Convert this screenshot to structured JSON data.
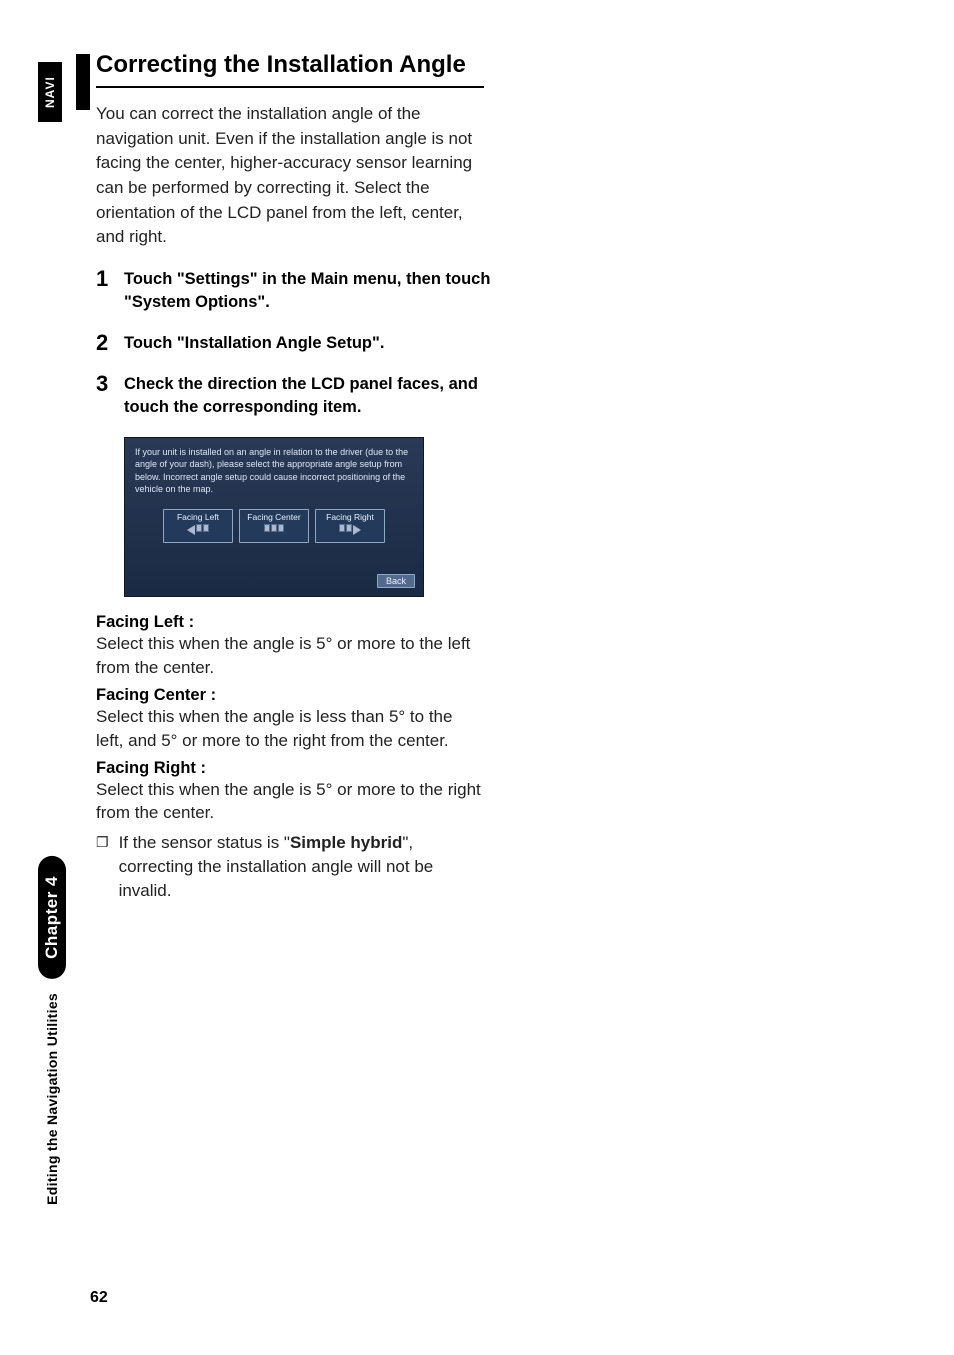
{
  "side": {
    "navi": "NAVI",
    "chapter": "Chapter 4",
    "section": "Editing the Navigation Utilities"
  },
  "page_number": "62",
  "title": "Correcting the Installation Angle",
  "intro": "You can correct the installation angle of the navigation unit. Even if the installation angle is not facing the center, higher-accuracy sensor learning can be performed by correcting it. Select the orientation of the LCD panel from the left, center, and right.",
  "steps": [
    "Touch \"Settings\" in the Main menu, then touch \"System Options\".",
    "Touch \"Installation Angle Setup\".",
    "Check the direction the LCD panel faces, and touch the corresponding item."
  ],
  "screenshot": {
    "text": "If your unit is installed on an angle in relation to the driver (due to the angle of your dash), please select the appropriate angle setup from below. Incorrect angle setup could cause incorrect positioning of the vehicle on the map.",
    "buttons": [
      "Facing Left",
      "Facing Center",
      "Facing Right"
    ],
    "back": "Back"
  },
  "definitions": [
    {
      "term": "Facing Left :",
      "desc": "Select this when the angle is 5° or more to the left from the center."
    },
    {
      "term": "Facing Center :",
      "desc": "Select this when the angle is less than 5° to the left, and 5° or more to the right from the center."
    },
    {
      "term": "Facing Right :",
      "desc": "Select this when the angle is 5° or more to the right from the center."
    }
  ],
  "note": {
    "prefix": "If the sensor status is \"",
    "bold": "Simple hybrid",
    "suffix": "\", correcting the installation angle will not be invalid."
  }
}
